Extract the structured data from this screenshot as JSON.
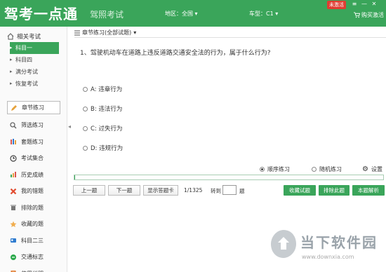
{
  "header": {
    "logo": "驾考一点通",
    "subtitle": "驾照考试",
    "region": "地区：全国 ▾",
    "car_type": "车型：C1 ▾",
    "badge": "未激活",
    "buy": "购买激活",
    "window_controls": [
      "≡",
      "—",
      "✕"
    ]
  },
  "sidebar": {
    "related_label": "相关考试",
    "subjects": [
      "科目一",
      "科目四",
      "满分考试",
      "恢复考试"
    ],
    "menu": [
      {
        "label": "章节练习",
        "icon": "pencil-icon",
        "color": "#e6a23c"
      },
      {
        "label": "筛选练习",
        "icon": "magnifier-icon",
        "color": "#666666"
      },
      {
        "label": "套题练习",
        "icon": "books-icon",
        "color": "#d9534f"
      },
      {
        "label": "考试集合",
        "icon": "clock-icon",
        "color": "#444444"
      },
      {
        "label": "历史成绩",
        "icon": "bar-chart-icon",
        "color": "#3aa55a"
      },
      {
        "label": "我的错题",
        "icon": "x-mark-icon",
        "color": "#e14b2f"
      },
      {
        "label": "排除的题",
        "icon": "trash-icon",
        "color": "#777777"
      },
      {
        "label": "收藏的题",
        "icon": "star-icon",
        "color": "#f0ad4e"
      },
      {
        "label": "科目二三",
        "icon": "id-card-icon",
        "color": "#2e7bcf"
      },
      {
        "label": "交通标志",
        "icon": "traffic-light-icon",
        "color": "#2aa84a"
      },
      {
        "label": "使用说明",
        "icon": "book-icon",
        "color": "#e07b2e"
      }
    ]
  },
  "main": {
    "breadcrumb": "章节练习(全部试题)",
    "question": "1、驾驶机动车在道路上违反道路交通安全法的行为，属于什么行为?",
    "options": [
      "A: 违章行为",
      "B: 违法行为",
      "C: 过失行为",
      "D: 违规行为"
    ],
    "modes": {
      "sequential": "顺序练习",
      "random": "随机练习",
      "settings": "设置"
    },
    "toolbar": {
      "prev": "上一题",
      "next": "下一题",
      "answer_card": "显示答题卡",
      "page": "1/1325",
      "goto_label": "转到",
      "goto_suffix": "题",
      "favorite": "收藏试题",
      "exclude": "排除此题",
      "explain": "本题解析"
    },
    "progress_percent": 0.1
  },
  "watermark": {
    "name": "当下软件园",
    "url": "www.downxia.com"
  }
}
